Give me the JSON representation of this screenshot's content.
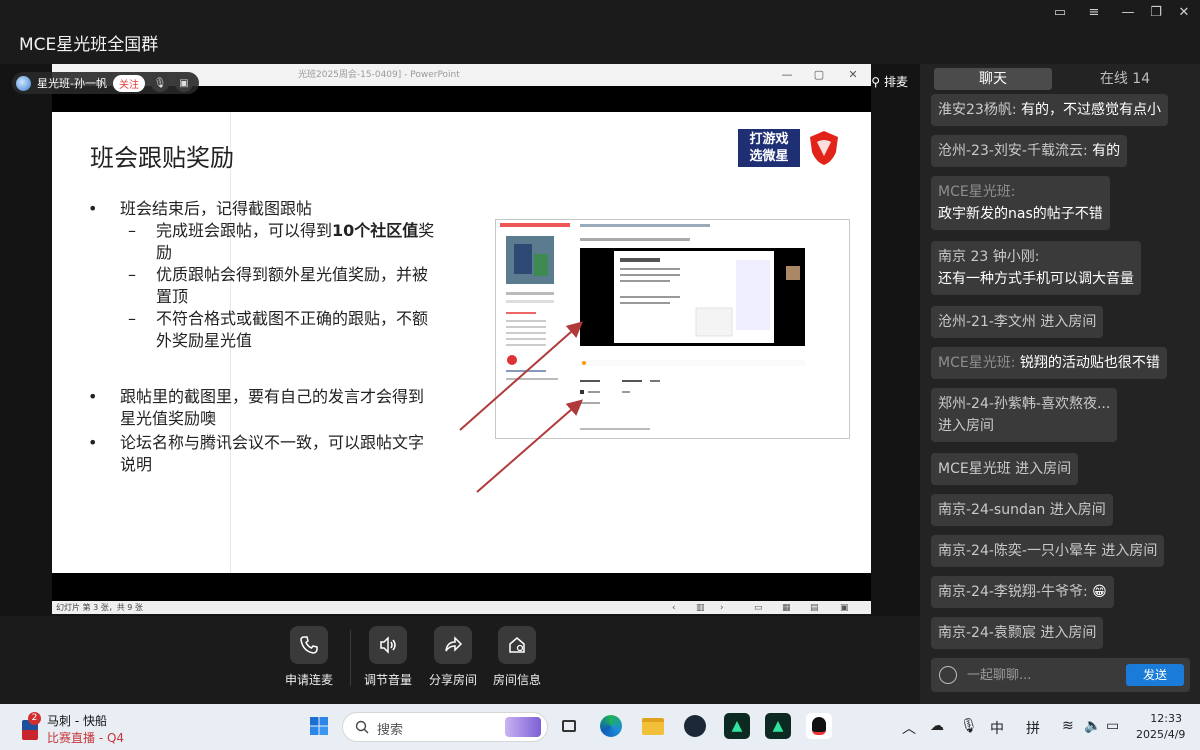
{
  "window": {
    "title": "MCE星光班全国群"
  },
  "stage": {
    "host_name": "星光班-孙一帆",
    "follow_label": "关注",
    "paimai_label": "排麦"
  },
  "ppt": {
    "title_text": "光班2025周会-15-0409] - PowerPoint",
    "status_text": "幻灯片 第 3 张，共 9 张",
    "slide": {
      "title": "班会跟贴奖励",
      "bullets": [
        "班会结束后，记得截图跟帖",
        "完成班会跟帖，可以得到",
        "10个社区值",
        "奖励",
        "优质跟帖会得到额外星光值奖励，并被置顶",
        "不符合格式或截图不正确的跟贴，不额外奖励星光值",
        "跟帖里的截图里，要有自己的发言才会得到星光值奖励噢",
        "论坛名称与腾讯会议不一致，可以跟帖文字说明"
      ],
      "brand_text_line1": "打游戏",
      "brand_text_line2": "选微星"
    }
  },
  "controls": [
    {
      "label": "申请连麦",
      "icon": "phone-icon"
    },
    {
      "label": "调节音量",
      "icon": "speaker-icon"
    },
    {
      "label": "分享房间",
      "icon": "share-icon"
    },
    {
      "label": "房间信息",
      "icon": "room-info-icon"
    }
  ],
  "chat": {
    "tab_chat": "聊天",
    "tab_online": "在线 14",
    "messages": [
      {
        "sender": "淮安23杨帆:",
        "text": " 有的，不过感觉有点小"
      },
      {
        "sender": "沧州-23-刘安-千载流云:",
        "text": " 有的"
      },
      {
        "sender": "MCE星光班:",
        "text": "政宇新发的nas的帖子不错"
      },
      {
        "sender": "南京 23 钟小刚:",
        "text": "还有一种方式手机可以调大音量"
      },
      {
        "sender": "沧州-21-李文州",
        "text": " 进入房间"
      },
      {
        "sender": "MCE星光班:",
        "text": " 锐翔的活动贴也很不错"
      },
      {
        "sender": "郑州-24-孙紫韩-喜欢熬夜...",
        "text": " 进入房间"
      },
      {
        "sender": "MCE星光班",
        "text": " 进入房间"
      },
      {
        "sender": "南京-24-sundan",
        "text": " 进入房间"
      },
      {
        "sender": "南京-24-陈奕-一只小晕车",
        "text": " 进入房间"
      },
      {
        "sender": "南京-24-李锐翔-牛爷爷:",
        "text": " 😁"
      },
      {
        "sender": "南京-24-袁颢宸",
        "text": " 进入房间"
      }
    ],
    "input_placeholder": "一起聊聊...",
    "send_label": "发送"
  },
  "taskbar": {
    "notif_count": "2",
    "app_line1": "马刺 - 快船",
    "app_line2": "比赛直播 - Q4",
    "search_label": "搜索",
    "ime_lang": "中",
    "ime_mode": "拼",
    "time": "12:33",
    "date": "2025/4/9"
  },
  "colors": {
    "accent": "#1a7bd8",
    "bubble": "#3a3a3a",
    "chat_bg": "#232323",
    "arrow": "#b03a3a"
  }
}
